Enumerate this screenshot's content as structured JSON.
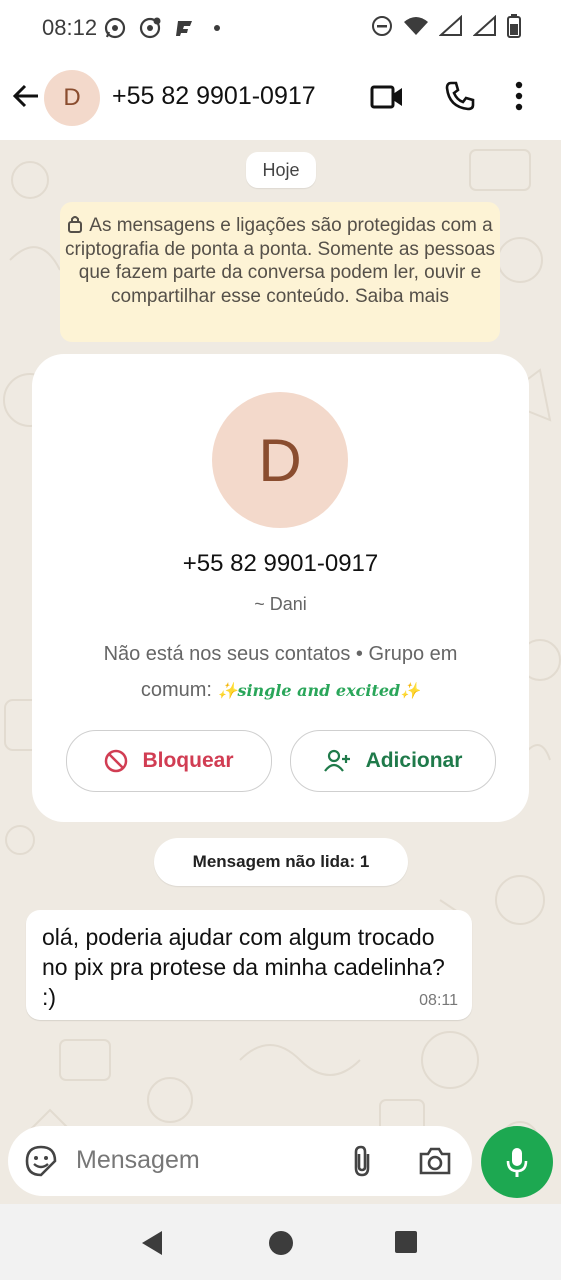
{
  "status_bar": {
    "time": "08:12"
  },
  "header": {
    "avatar_letter": "D",
    "title": "+55 82 9901-0917"
  },
  "chat": {
    "date_pill": "Hoje",
    "encryption_notice": "As mensagens e ligações são protegidas com a criptografia de ponta a ponta. Somente as pessoas que fazem parte da conversa podem ler, ouvir e compartilhar esse conteúdo. Saiba mais",
    "contact_card": {
      "avatar_letter": "D",
      "phone": "+55 82 9901-0917",
      "name": "~ Dani",
      "info_prefix": "Não está nos seus contatos • Grupo em comum: ",
      "group_name": "✨single and excited✨",
      "block_label": "Bloquear",
      "add_label": "Adicionar"
    },
    "unread_pill": "Mensagem não lida: 1",
    "messages": [
      {
        "text": "olá, poderia ajudar com algum trocado no pix pra protese da minha cadelinha? :)",
        "time": "08:11"
      }
    ]
  },
  "input": {
    "placeholder": "Mensagem"
  },
  "colors": {
    "accent": "#1da851",
    "block_red": "#d13d53",
    "add_green": "#1f7a4a"
  },
  "icons": [
    "whatsapp-icon",
    "whatsapp-business-icon",
    "app-icon",
    "dnd-icon",
    "wifi-icon",
    "signal-icon",
    "battery-icon",
    "back-arrow-icon",
    "video-call-icon",
    "phone-call-icon",
    "more-options-icon",
    "lock-icon",
    "block-icon",
    "add-contact-icon",
    "sticker-icon",
    "attach-icon",
    "camera-icon",
    "mic-icon"
  ]
}
